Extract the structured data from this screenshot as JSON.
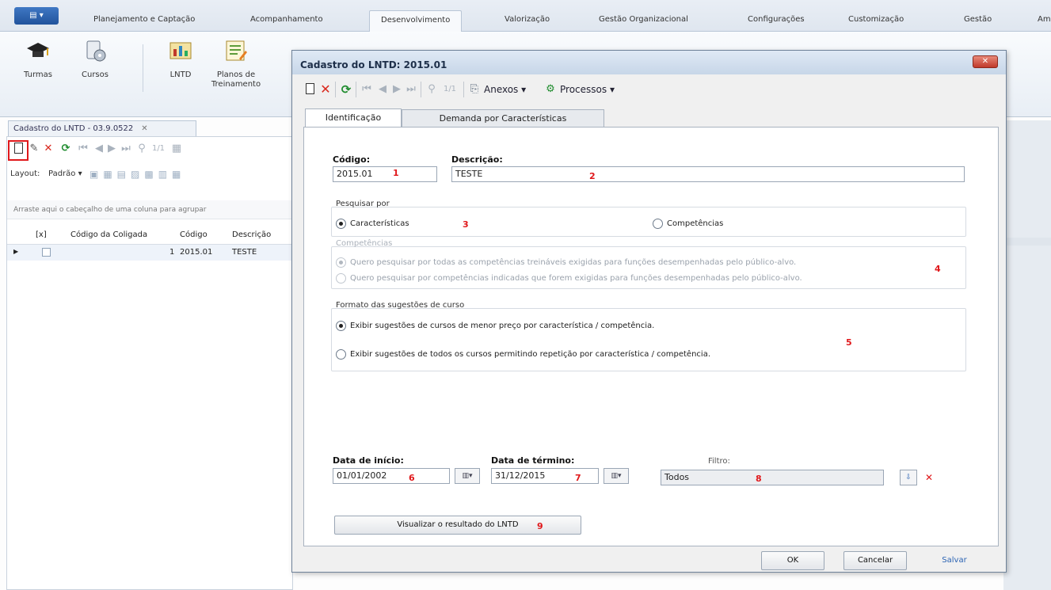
{
  "app": {
    "app_button": "▤ ▾",
    "ribbon_tabs": [
      "Planejamento e Captação",
      "Acompanhamento",
      "Desenvolvimento",
      "Valorização",
      "Gestão Organizacional",
      "Configurações",
      "Customização",
      "Gestão",
      "Am"
    ],
    "active_tab": "Desenvolvimento",
    "ribbon_buttons": [
      "Turmas",
      "Cursos",
      "LNTD",
      "Planos de\nTreinamento"
    ]
  },
  "left": {
    "doc_tab": "Cadastro do LNTD - 03.9.0522",
    "nav_pos": "1/1",
    "layout_label": "Layout:",
    "layout_value": "Padrão ▾",
    "group_hint": "Arraste aqui o cabeçalho de uma coluna para agrupar",
    "columns": [
      "[x]",
      "Código da Coligada",
      "Código",
      "Descrição"
    ],
    "row": {
      "coligada": "1",
      "codigo": "2015.01",
      "descricao": "TESTE"
    }
  },
  "dialog": {
    "title": "Cadastro do LNTD: 2015.01",
    "close": "✕",
    "nav_pos": "1/1",
    "anexos": "Anexos",
    "processos": "Processos",
    "tabs": [
      "Identificação",
      "Demanda por Características"
    ],
    "codigo_label": "Código:",
    "codigo_value": "2015.01",
    "descricao_label": "Descrição:",
    "descricao_value": "TESTE",
    "pesquisar_title": "Pesquisar por",
    "opt_caracteristicas": "Características",
    "opt_competencias": "Competências",
    "competencias_title": "Competências",
    "comp_opt1": "Quero pesquisar por todas as competências treináveis exigidas para funções desempenhadas pelo público-alvo.",
    "comp_opt2": "Quero pesquisar por competências indicadas que forem exigidas para funções desempenhadas pelo público-alvo.",
    "formato_title": "Formato das sugestões de curso",
    "fmt_opt1": "Exibir sugestões de cursos de menor preço por característica / competência.",
    "fmt_opt2": "Exibir sugestões de todos os cursos permitindo repetição por característica / competência.",
    "data_inicio_label": "Data de início:",
    "data_inicio_value": "01/01/2002",
    "data_termino_label": "Data de término:",
    "data_termino_value": "31/12/2015",
    "filtro_label": "Filtro:",
    "filtro_value": "Todos",
    "visualizar_btn": "Visualizar o resultado do LNTD",
    "ok_btn": "OK",
    "cancelar_btn": "Cancelar",
    "salvar_btn": "Salvar"
  },
  "annotations": [
    "1",
    "2",
    "3",
    "4",
    "5",
    "6",
    "7",
    "8",
    "9"
  ],
  "colors": {
    "annotation_red": "#e0181b",
    "ribbon_blue": "#21539c"
  }
}
